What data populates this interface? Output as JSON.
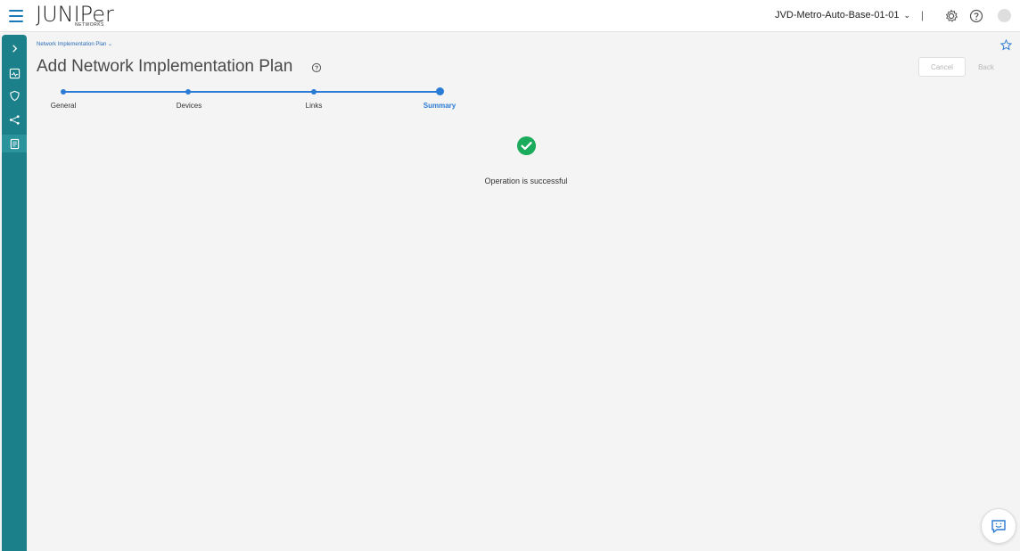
{
  "brand": {
    "logo_text": "JUNIPer",
    "logo_subtext": "NETWORKS"
  },
  "header": {
    "site_selector": "JVD-Metro-Auto-Base-01-01",
    "separator": "|"
  },
  "icons": {
    "menu": "hamburger-icon",
    "settings": "gear-icon",
    "help": "help-circle-icon",
    "favorite": "star-icon",
    "chat": "chat-icon",
    "success": "check-circle-icon"
  },
  "sidebar": {
    "items": [
      {
        "icon": "chevron-right-icon"
      },
      {
        "icon": "monitor-icon"
      },
      {
        "icon": "shield-icon"
      },
      {
        "icon": "topology-icon"
      },
      {
        "icon": "document-icon",
        "active": true
      }
    ]
  },
  "breadcrumb": {
    "label": "Network Implementation Plan",
    "chevron": "⌄"
  },
  "page": {
    "title": "Add Network Implementation Plan"
  },
  "actions": {
    "cancel": "Cancel",
    "back": "Back"
  },
  "stepper": {
    "steps": [
      "General",
      "Devices",
      "Links",
      "Summary"
    ],
    "current_index": 3
  },
  "result": {
    "message": "Operation is successful"
  },
  "colors": {
    "accent": "#2a7bd4",
    "rail": "#1b808a",
    "success": "#1aab5d"
  }
}
